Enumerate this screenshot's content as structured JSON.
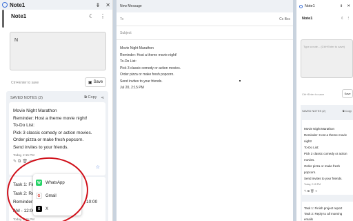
{
  "left_panel": {
    "window_title": "Note1",
    "header_title": "Note1",
    "editor_text": "N",
    "hint": "Ctrl+Enter to save",
    "save_label": "Save",
    "saved_notes_label": "SAVED NOTES (2)",
    "copy_label": "Copy",
    "note1_lines": [
      "Movie Night Marathon",
      "Reminder: Host a theme movie night!",
      "To-Do List:",
      "Pick 3 classic comedy or action movies.",
      "Order pizza or make fresh popcorn.",
      "Send invites to your friends."
    ],
    "note1_timestamp": "Today, 2:15 PM",
    "note2_lines": [
      "Task 1: Fini",
      "Task 2: Rep",
      "Reminder:",
      "AM - 12:00"
    ],
    "note2_tail": "10:00",
    "note2_timestamp": "Today, 2:15 PM"
  },
  "share_menu": {
    "items": [
      {
        "label": "WhatsApp",
        "icon": "whatsapp-icon",
        "glyph": "W"
      },
      {
        "label": "Gmail",
        "icon": "gmail-icon",
        "glyph": "G"
      },
      {
        "label": "X",
        "icon": "x-icon",
        "glyph": "X"
      }
    ]
  },
  "compose": {
    "title": "New Message",
    "to_label": "To",
    "cc_bcc": "Cc Bcc",
    "subject_label": "Subject",
    "body_lines": [
      "Movie Night Marathon",
      "Reminder: Host a theme movie night!",
      "To-Do List:",
      "Pick 3 classic comedy or action movies.",
      "Order pizza or make fresh popcorn.",
      "Send invites to your friends.",
      "Jul 20, 2:15 PM"
    ]
  },
  "right_panel": {
    "window_title": "Note1",
    "header_title": "Note1",
    "editor_placeholder": "Type a note... (Ctrl+Enter to save)",
    "hint": "Ctrl+Enter to save",
    "save_label": "Save",
    "saved_notes_label": "SAVED NOTES (2)",
    "copy_label": "Copy",
    "note1_lines": [
      "Movie Night Marathon",
      "Reminder: Host a theme movie night!",
      "To-Do List:",
      "Pick 3 classic comedy or action movies.",
      "Order pizza or make fresh popcorn.",
      "Send invites to your friends."
    ],
    "note1_timestamp": "Today, 2:15 PM",
    "note2_lines": [
      "Task 1: Finish project report",
      "Task 2: Reply to all morning emails"
    ]
  },
  "colors": {
    "accent": "#3a6fd8",
    "annotation_red": "#d0101a",
    "whatsapp": "#25d366"
  }
}
